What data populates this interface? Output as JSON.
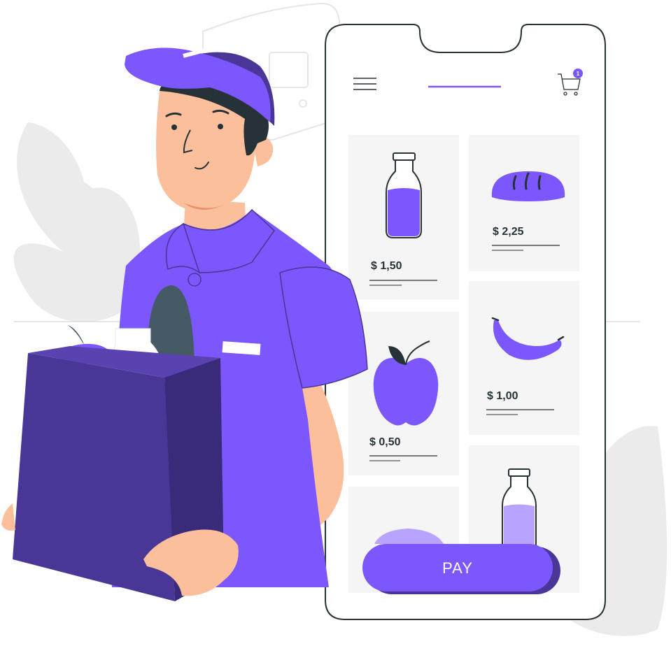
{
  "colors": {
    "primary": "#7c57fe",
    "primary_dark": "#4a3696",
    "primary_light": "#b8a4ff",
    "skin": "#fbbf9b",
    "hair": "#263238",
    "bread": "#455a64",
    "background_leaf": "#ebebeb",
    "card": "#f5f5f5"
  },
  "app": {
    "cart": {
      "badge_count": "1"
    },
    "products": [
      {
        "item": "milk-bottle",
        "price": "$ 1,50"
      },
      {
        "item": "bread",
        "price": "$ 2,25"
      },
      {
        "item": "apple",
        "price": "$ 0,50"
      },
      {
        "item": "banana",
        "price": "$ 1,00"
      },
      {
        "item": "cabbage",
        "price": ""
      },
      {
        "item": "milk-bottle",
        "price": ""
      }
    ],
    "pay_label": "PAY"
  }
}
